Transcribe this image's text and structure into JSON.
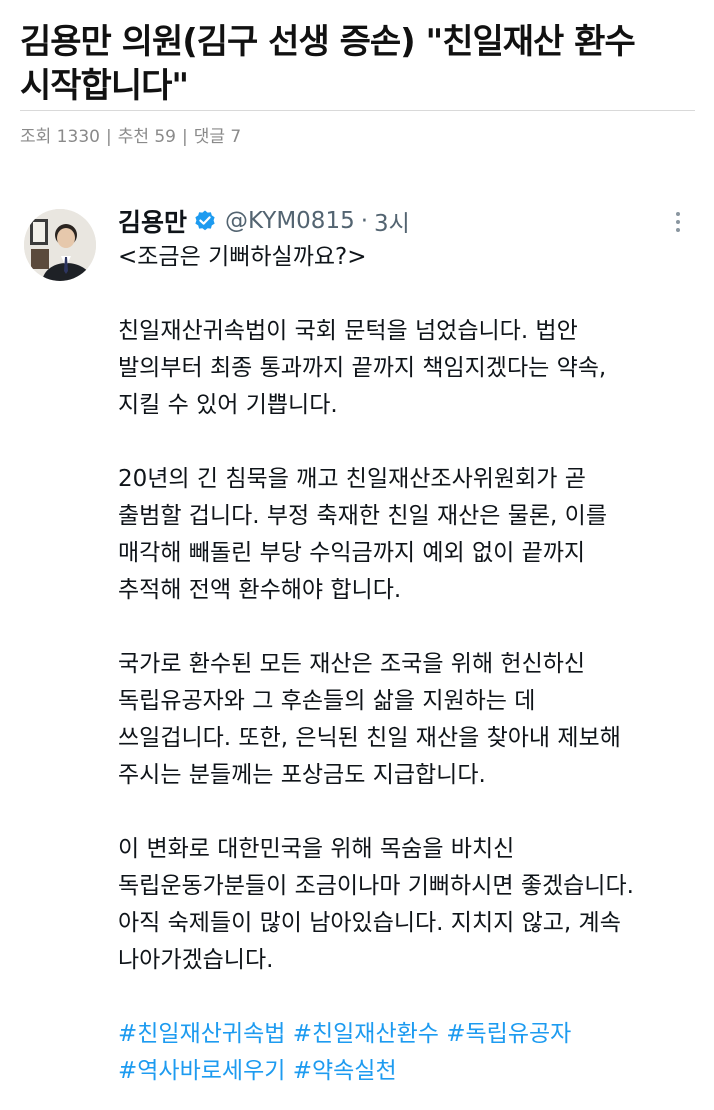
{
  "article": {
    "title_line1": "김용만 의원(김구 선생 증손) \"친일재산 환수",
    "title_line2": "시작합니다\"",
    "views_label": "조회 1330",
    "recommend_label": "추천 59",
    "comments_label": "댓글 7",
    "separator": "|"
  },
  "tweet": {
    "author_name": "김용만",
    "handle": "@KYM0815",
    "dot": "·",
    "time": "3시",
    "avatar_icon": "profile-photo",
    "verified_icon": "verified-badge-icon",
    "more_icon": "more-vertical-icon",
    "subtitle": "<조금은 기뻐하실까요?>",
    "paragraphs": [
      [
        "친일재산귀속법이 국회 문턱을 넘었습니다. 법안",
        "발의부터 최종 통과까지 끝까지 책임지겠다는 약속,",
        "지킬 수 있어 기쁩니다."
      ],
      [
        "20년의 긴 침묵을 깨고 친일재산조사위원회가 곧",
        "출범할 겁니다. 부정 축재한 친일 재산은 물론, 이를",
        "매각해 빼돌린 부당 수익금까지 예외 없이 끝까지",
        "추적해 전액 환수해야 합니다."
      ],
      [
        "국가로 환수된 모든 재산은 조국을 위해 헌신하신",
        "독립유공자와 그 후손들의 삶을 지원하는 데",
        "쓰일겁니다. 또한, 은닉된 친일 재산을 찾아내 제보해",
        "주시는 분들께는 포상금도 지급합니다."
      ],
      [
        "이 변화로 대한민국을 위해 목숨을 바치신",
        "독립운동가분들이 조금이나마 기뻐하시면 좋겠습니다.",
        "아직 숙제들이 많이 남아있습니다. 지치지 않고, 계속",
        "나아가겠습니다."
      ]
    ],
    "hashtags_line1": "#친일재산귀속법 #친일재산환수 #독립유공자",
    "hashtags_line2": "#역사바로세우기 #약속실천"
  },
  "colors": {
    "text": "#0f1419",
    "secondary": "#536471",
    "hashtag": "#1d9bf0",
    "meta": "#8a8a8a"
  }
}
